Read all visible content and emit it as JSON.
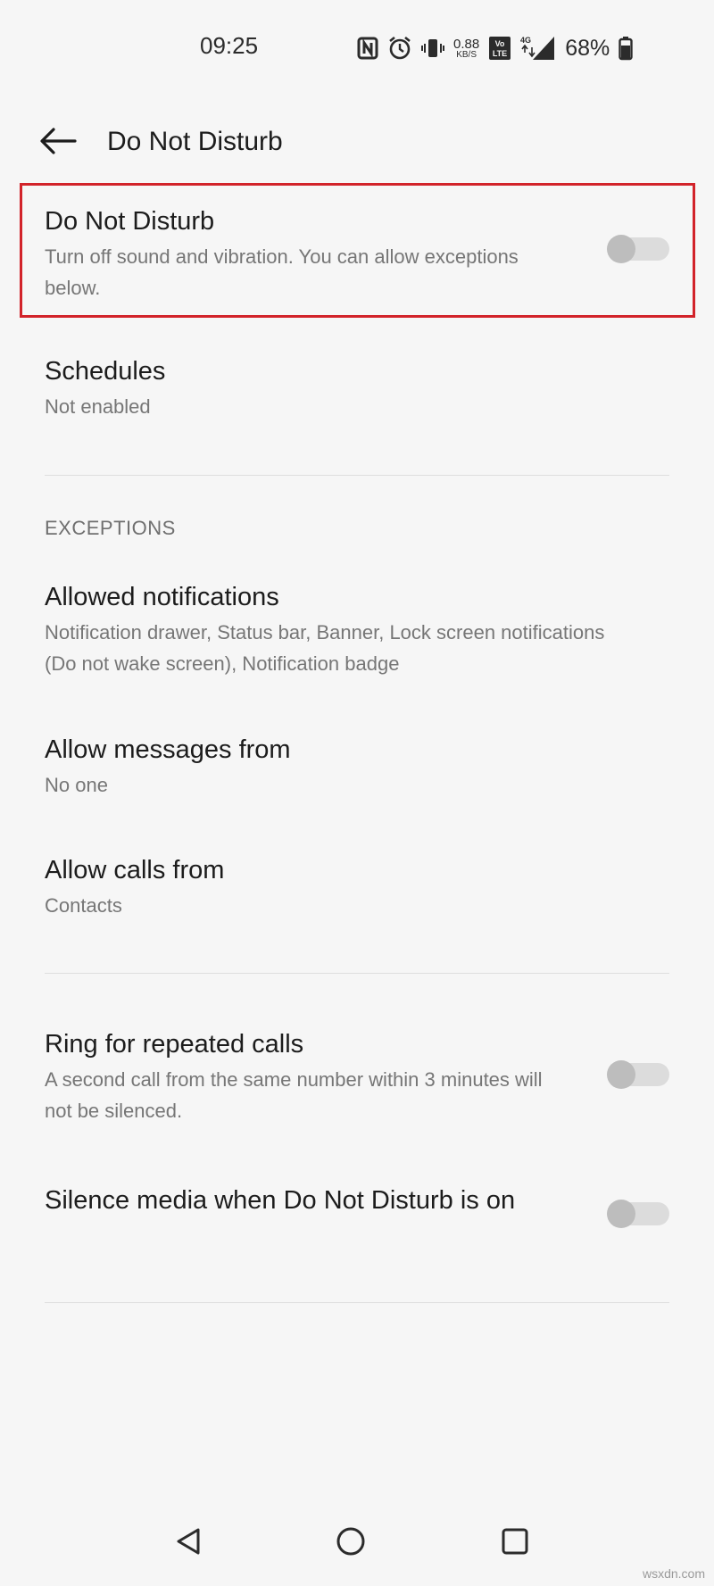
{
  "status_bar": {
    "time": "09:25",
    "net_speed_value": "0.88",
    "net_speed_unit": "KB/S",
    "network_type": "4G",
    "battery_percent": "68%",
    "icons": [
      "nfc-icon",
      "alarm-icon",
      "vibrate-icon",
      "volte-icon",
      "signal-icon",
      "battery-icon"
    ]
  },
  "app_bar": {
    "title": "Do Not Disturb",
    "back_icon": "arrow-left-icon"
  },
  "settings": {
    "dnd": {
      "title": "Do Not Disturb",
      "subtitle": "Turn off sound and vibration. You can allow exceptions below.",
      "enabled": false
    },
    "schedules": {
      "title": "Schedules",
      "subtitle": "Not enabled"
    },
    "exceptions_header": "EXCEPTIONS",
    "allowed_notifications": {
      "title": "Allowed notifications",
      "subtitle": "Notification drawer, Status bar, Banner, Lock screen notifications (Do not wake screen), Notification badge"
    },
    "allow_messages": {
      "title": "Allow messages from",
      "subtitle": "No one"
    },
    "allow_calls": {
      "title": "Allow calls from",
      "subtitle": "Contacts"
    },
    "repeated_calls": {
      "title": "Ring for repeated calls",
      "subtitle": "A second call from the same number within 3 minutes will not be silenced.",
      "enabled": false
    },
    "silence_media": {
      "title": "Silence media when Do Not Disturb is on",
      "enabled": false
    }
  },
  "highlight_color": "#d2232a",
  "nav_bar": {
    "icons": [
      "back-triangle-icon",
      "home-circle-icon",
      "recents-square-icon"
    ]
  },
  "watermark": "wsxdn.com"
}
